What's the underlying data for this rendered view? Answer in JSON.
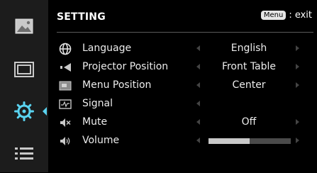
{
  "header": {
    "title": "SETTING",
    "menu_key": "Menu",
    "exit_text": ": exit"
  },
  "sidebar": [
    {
      "icon": "picture-icon"
    },
    {
      "icon": "screen-icon"
    },
    {
      "icon": "setting-gear-icon",
      "active": true
    },
    {
      "icon": "list-menu-icon"
    }
  ],
  "settings": [
    {
      "label": "Language",
      "value": "English",
      "icon": "globe-icon"
    },
    {
      "label": "Projector Position",
      "value": "Front Table",
      "icon": "projector-position-icon"
    },
    {
      "label": "Menu Position",
      "value": "Center",
      "icon": "menu-position-icon"
    },
    {
      "label": "Signal",
      "value": "",
      "icon": "signal-icon"
    },
    {
      "label": "Mute",
      "value": "Off",
      "icon": "mute-icon"
    },
    {
      "label": "Volume",
      "value": "",
      "icon": "volume-icon",
      "level": 0.5
    }
  ],
  "colors": {
    "accent": "#5ad3f0",
    "panel": "#1c1c1c",
    "background": "#000000"
  }
}
